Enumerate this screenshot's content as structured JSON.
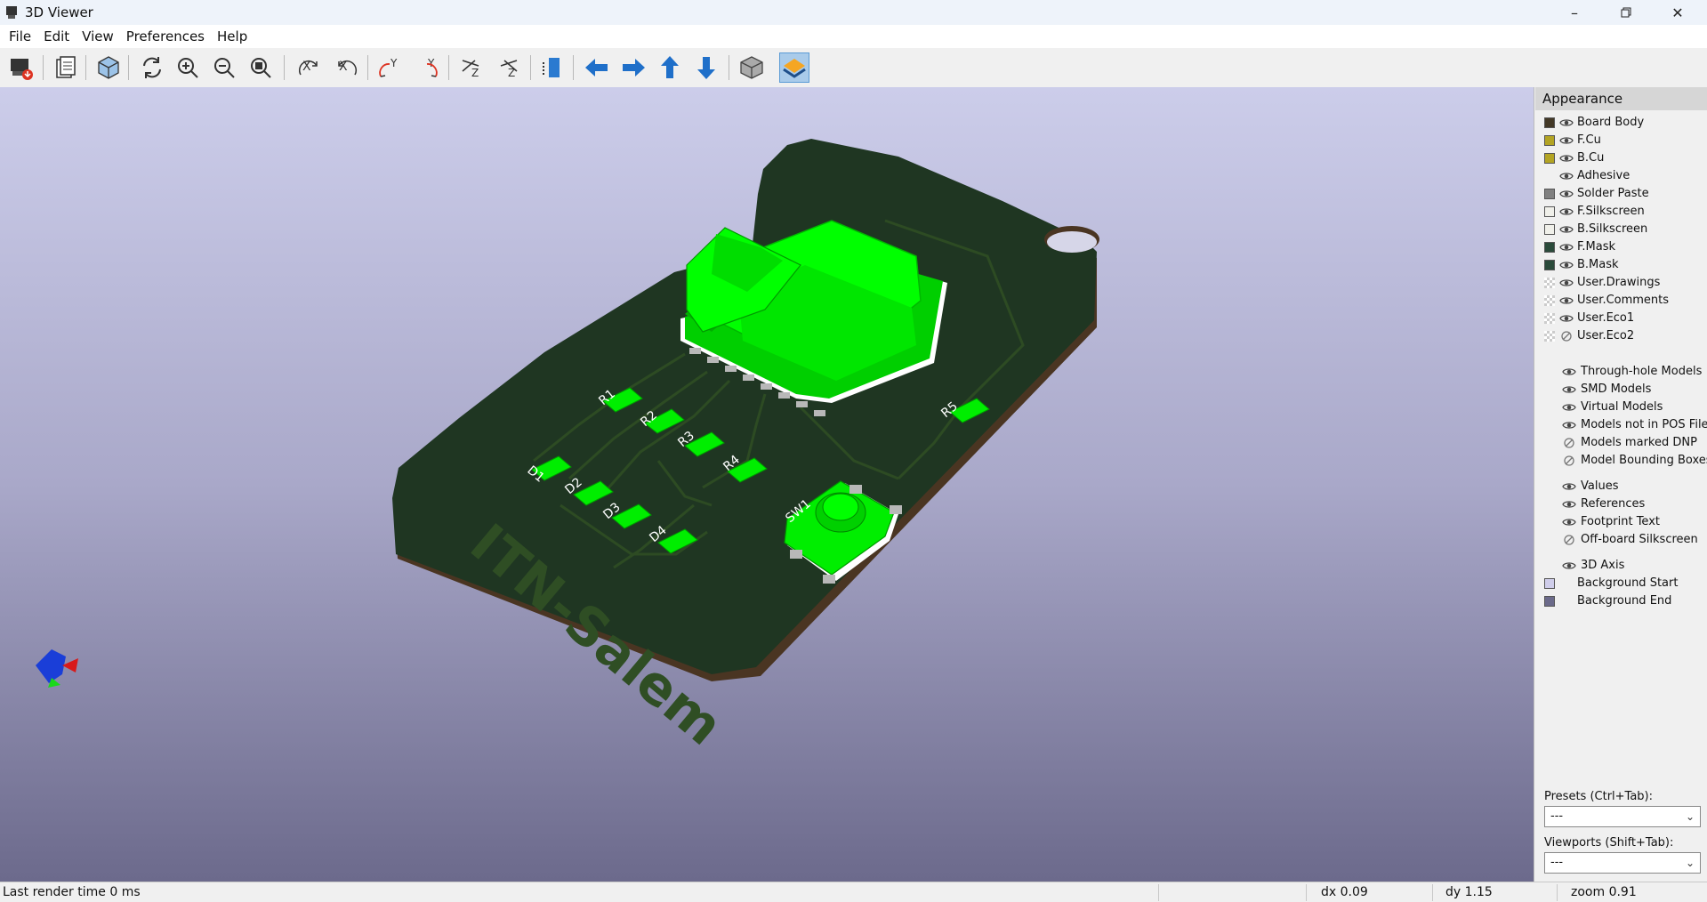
{
  "window": {
    "title": "3D Viewer"
  },
  "menu": [
    "File",
    "Edit",
    "View",
    "Preferences",
    "Help"
  ],
  "toolbar": {
    "items": [
      {
        "name": "export-image-icon"
      },
      {
        "name": "copy-to-clipboard-icon"
      },
      {
        "name": "raytracing-icon"
      },
      {
        "name": "reload-board-icon"
      },
      {
        "name": "zoom-in-icon"
      },
      {
        "name": "zoom-out-icon"
      },
      {
        "name": "zoom-fit-icon"
      },
      {
        "name": "rotate-x-cw-icon"
      },
      {
        "name": "rotate-x-ccw-icon"
      },
      {
        "name": "rotate-y-cw-icon"
      },
      {
        "name": "rotate-y-ccw-icon"
      },
      {
        "name": "rotate-z-cw-icon"
      },
      {
        "name": "rotate-z-ccw-icon"
      },
      {
        "name": "flip-view-icon"
      },
      {
        "name": "move-left-icon"
      },
      {
        "name": "move-right-icon"
      },
      {
        "name": "move-up-icon"
      },
      {
        "name": "move-down-icon"
      },
      {
        "name": "orthographic-icon"
      },
      {
        "name": "toggle-layers-panel-icon"
      }
    ]
  },
  "board": {
    "silkscreen_text": "ITN-Salem",
    "refs": [
      "R1",
      "R2",
      "R3",
      "R4",
      "R5",
      "D1",
      "D2",
      "D3",
      "D4",
      "SW1"
    ]
  },
  "appearance": {
    "title": "Appearance",
    "layers": [
      {
        "label": "Board Body",
        "color": "#433927",
        "eye": true
      },
      {
        "label": "F.Cu",
        "color": "#b3a423",
        "eye": true
      },
      {
        "label": "B.Cu",
        "color": "#b3a423",
        "eye": true
      },
      {
        "label": "Adhesive",
        "color": null,
        "eye": true
      },
      {
        "label": "Solder Paste",
        "color": "#808080",
        "eye": true
      },
      {
        "label": "F.Silkscreen",
        "color": "#f0f0ea",
        "eye": true
      },
      {
        "label": "B.Silkscreen",
        "color": "#f0f0ea",
        "eye": true
      },
      {
        "label": "F.Mask",
        "color": "#2a4a3a",
        "eye": true
      },
      {
        "label": "B.Mask",
        "color": "#2a4a3a",
        "eye": true
      },
      {
        "label": "User.Drawings",
        "color": "checker",
        "eye": true
      },
      {
        "label": "User.Comments",
        "color": "checker",
        "eye": true
      },
      {
        "label": "User.Eco1",
        "color": "checker",
        "eye": true
      },
      {
        "label": "User.Eco2",
        "color": "checker",
        "eye": false
      }
    ],
    "models": [
      {
        "label": "Through-hole Models",
        "eye": true
      },
      {
        "label": "SMD Models",
        "eye": true
      },
      {
        "label": "Virtual Models",
        "eye": true
      },
      {
        "label": "Models not in POS File",
        "eye": true
      },
      {
        "label": "Models marked DNP",
        "eye": false
      },
      {
        "label": "Model Bounding Boxes",
        "eye": false
      }
    ],
    "text": [
      {
        "label": "Values",
        "eye": true
      },
      {
        "label": "References",
        "eye": true
      },
      {
        "label": "Footprint Text",
        "eye": true
      },
      {
        "label": "Off-board Silkscreen",
        "eye": false
      }
    ],
    "misc": [
      {
        "label": "3D Axis",
        "eye": true,
        "color": null
      },
      {
        "label": "Background Start",
        "eye": null,
        "color": "#cfcdea"
      },
      {
        "label": "Background End",
        "eye": null,
        "color": "#6b6a8a"
      }
    ],
    "presets_label": "Presets (Ctrl+Tab):",
    "presets_value": "---",
    "viewports_label": "Viewports (Shift+Tab):",
    "viewports_value": "---"
  },
  "status": {
    "render_time": "Last render time 0 ms",
    "dx": "dx 0.09",
    "dy": "dy 1.15",
    "zoom": "zoom 0.91"
  }
}
